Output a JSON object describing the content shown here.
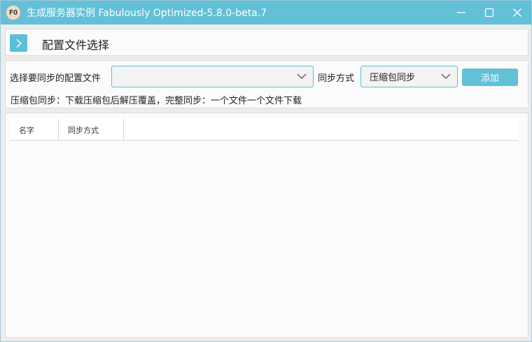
{
  "window": {
    "icon_text": "FO",
    "title": "生成服务器实例 Fabulously Optimized-5.8.0-beta.7"
  },
  "header": {
    "title": "配置文件选择"
  },
  "config": {
    "file_label": "选择要同步的配置文件",
    "file_value": "",
    "sync_label": "同步方式",
    "sync_value": "压缩包同步",
    "add_label": "添加",
    "hint": "压缩包同步：下载压缩包后解压覆盖，完整同步：一个文件一个文件下载"
  },
  "table": {
    "columns": [
      "名字",
      "同步方式"
    ],
    "rows": []
  },
  "colors": {
    "accent": "#62c0d7",
    "panel": "#fbfbfb",
    "background": "#ececec"
  }
}
